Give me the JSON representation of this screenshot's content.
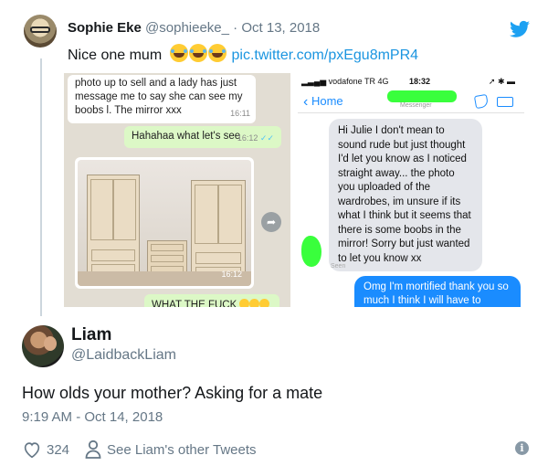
{
  "tweet": {
    "author_name": "Sophie Eke",
    "handle": "@sophieeke_",
    "separator": "·",
    "date": "Oct 13, 2018",
    "text": "Nice one mum",
    "link": "pic.twitter.com/pxEgu8mPR4"
  },
  "whatsapp": {
    "msg1": "photo up to sell and a lady has just message me to say she can see my boobs l. The mirror xxx",
    "msg1_time": "16:11",
    "msg2": "Hahahaa what let's see",
    "msg2_time": "16:12",
    "msg2_ticks": "✓✓",
    "photo_time": "16:12",
    "msg3": "WHAT THE FUCK"
  },
  "messenger": {
    "carrier": "vodafone TR  4G",
    "clock": "18:32",
    "back_label": "Home",
    "subtitle": "Messenger",
    "incoming": "Hi Julie I don't mean to sound rude but just thought I'd let you know as I noticed straight away... the photo you uploaded of the wardrobes, im unsure if its what I think but it seems that there is some boobs in the mirror! Sorry but just wanted to let you know xx",
    "seen": "Seen",
    "outgoing": "Omg I'm mortified thank you so much I think I will have to delete"
  },
  "reply": {
    "author_name": "Liam",
    "handle": "@LaidbackLiam",
    "text": "How olds your mother? Asking for a mate",
    "timestamp": "9:19 AM - Oct 14, 2018",
    "likes": "324",
    "other_tweets": "See Liam's other Tweets"
  },
  "colors": {
    "twitter_blue": "#1da1f2",
    "link_blue": "#1b95e0",
    "secondary_text": "#657786",
    "whatsapp_green": "#dcf8c6",
    "messenger_blue": "#1a8cff",
    "redaction_green": "#39ff3c"
  },
  "icons": [
    "twitter-bird-icon",
    "heart-icon",
    "person-icon",
    "info-icon",
    "share-icon",
    "phone-icon",
    "video-icon",
    "chevron-left-icon"
  ]
}
